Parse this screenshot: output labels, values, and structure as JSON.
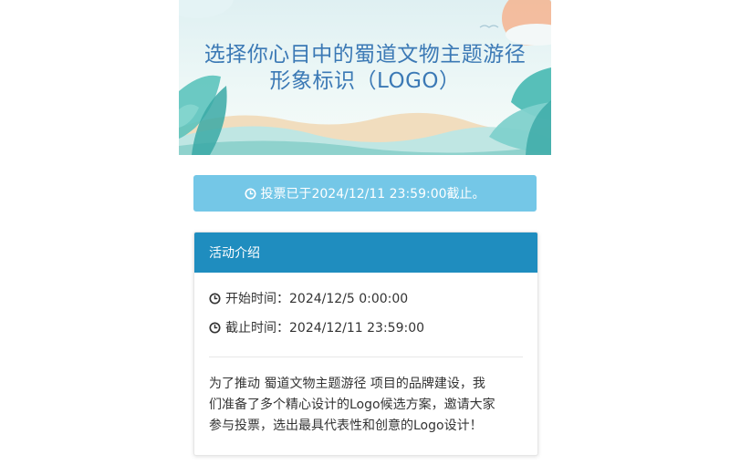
{
  "banner": {
    "title": "选择你心目中的蜀道文物主题游径\n形象标识（LOGO）"
  },
  "notice": {
    "icon": "clock-icon",
    "text": "投票已于2024/12/11 23:59:00截止。"
  },
  "intro": {
    "header": "活动介绍",
    "start_time": "开始时间：2024/12/5 0:00:00",
    "end_time": "截止时间：2024/12/11 23:59:00",
    "description": "为了推动 蜀道文物主题游径 项目的品牌建设，我\n们准备了多个精心设计的Logo候选方案，邀请大家\n参与投票，选出最具代表性和创意的Logo设计！"
  },
  "colors": {
    "notice_bg": "#74c7e7",
    "header_bg": "#1f8dbf",
    "title": "#3b79b5"
  }
}
